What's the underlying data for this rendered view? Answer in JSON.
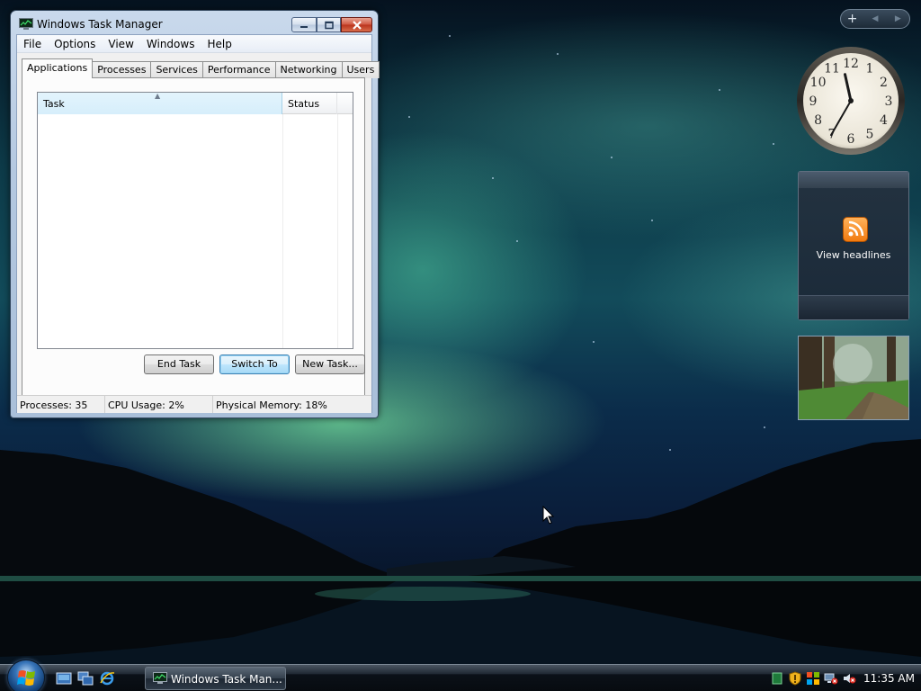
{
  "window": {
    "title": "Windows Task Manager"
  },
  "menu": {
    "items": [
      "File",
      "Options",
      "View",
      "Windows",
      "Help"
    ]
  },
  "tabs": {
    "items": [
      "Applications",
      "Processes",
      "Services",
      "Performance",
      "Networking",
      "Users"
    ],
    "active": "Applications"
  },
  "task_list": {
    "columns": [
      "Task",
      "Status"
    ],
    "rows": []
  },
  "buttons": {
    "end_task": "End Task",
    "switch_to": "Switch To",
    "new_task": "New Task..."
  },
  "status_bar": {
    "processes": "Processes: 35",
    "cpu_usage": "CPU Usage: 2%",
    "physical_memory": "Physical Memory: 18%"
  },
  "gadgets": {
    "sidebar_add": "+",
    "clock": {
      "hour": 11,
      "minute": 35,
      "numerals": [
        "12",
        "1",
        "2",
        "3",
        "4",
        "5",
        "6",
        "7",
        "8",
        "9",
        "10",
        "11"
      ]
    },
    "feed_headlines": {
      "label": "View headlines"
    },
    "slideshow": {
      "icon": "forest-path-photo"
    }
  },
  "taskbar": {
    "running_task": "Windows Task Man...",
    "quick_launch": [
      "show-desktop-icon",
      "switch-windows-icon",
      "internet-explorer-icon"
    ],
    "tray_icons": [
      "green-tray-icon",
      "security-shield-icon",
      "windows-flag-icon",
      "network-disconnected-icon",
      "volume-muted-icon"
    ],
    "clock": "11:35 AM"
  },
  "colors": {
    "aurora_green": "#78e6a0",
    "sky_deep": "#0a1d3a",
    "close_button_red": "#c84028",
    "selected_header": "#d6eefb",
    "rss_orange": "#f27b10"
  }
}
